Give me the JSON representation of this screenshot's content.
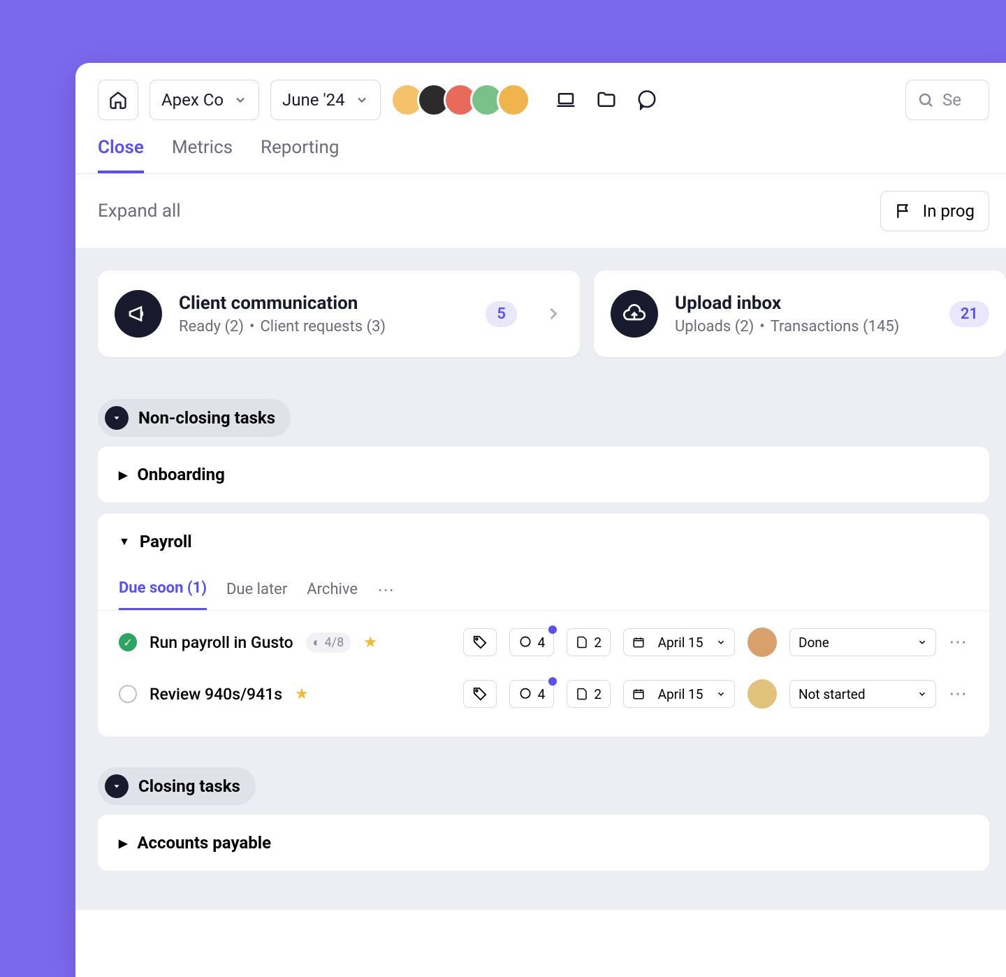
{
  "toolbar": {
    "company": "Apex Co",
    "period": "June '24",
    "search_placeholder": "Se"
  },
  "tabs": {
    "close": "Close",
    "metrics": "Metrics",
    "reporting": "Reporting"
  },
  "subbar": {
    "expand_all": "Expand all",
    "filter": "In prog"
  },
  "cards": {
    "comm": {
      "title": "Client communication",
      "ready": "Ready (2)",
      "requests": "Client requests (3)",
      "count": "5"
    },
    "inbox": {
      "title": "Upload inbox",
      "uploads": "Uploads (2)",
      "transactions": "Transactions (145)",
      "count": "21"
    }
  },
  "groups": {
    "nonclosing": "Non-closing tasks",
    "closing": "Closing tasks"
  },
  "sections": {
    "onboarding": "Onboarding",
    "payroll": "Payroll",
    "ap": "Accounts payable"
  },
  "subtabs": {
    "due_soon": "Due soon (1)",
    "due_later": "Due later",
    "archive": "Archive"
  },
  "tasks": [
    {
      "done": true,
      "name": "Run payroll in Gusto",
      "progress": "4/8",
      "comments": "4",
      "docs": "2",
      "date": "April 15",
      "status": "Done"
    },
    {
      "done": false,
      "name": "Review 940s/941s",
      "progress": "",
      "comments": "4",
      "docs": "2",
      "date": "April 15",
      "status": "Not started"
    }
  ]
}
